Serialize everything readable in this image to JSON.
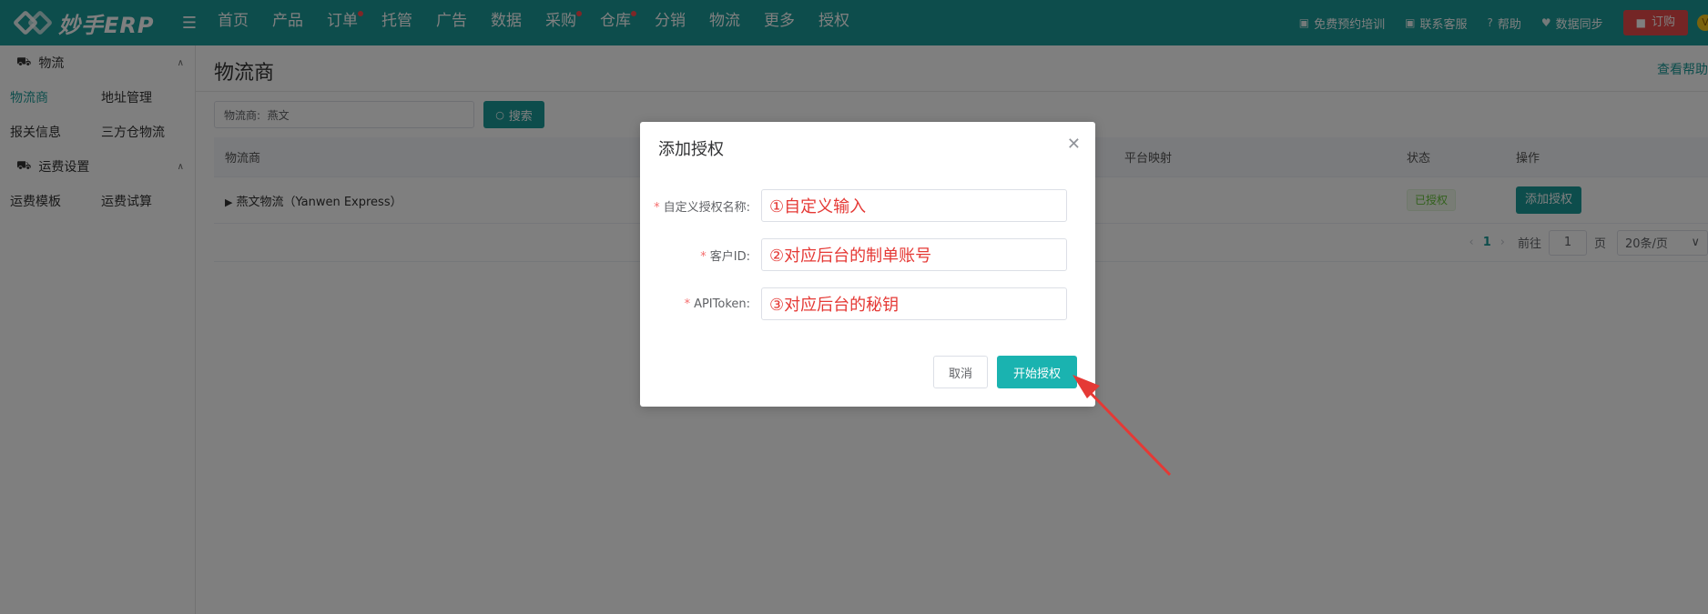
{
  "app": {
    "logo_text": "妙手ERP"
  },
  "nav": {
    "items": [
      {
        "label": "首页",
        "dot": false
      },
      {
        "label": "产品",
        "dot": false
      },
      {
        "label": "订单",
        "dot": true
      },
      {
        "label": "托管",
        "dot": false
      },
      {
        "label": "广告",
        "dot": false
      },
      {
        "label": "数据",
        "dot": false
      },
      {
        "label": "采购",
        "dot": true
      },
      {
        "label": "仓库",
        "dot": true
      },
      {
        "label": "分销",
        "dot": false
      },
      {
        "label": "物流",
        "dot": false
      },
      {
        "label": "更多",
        "dot": false
      },
      {
        "label": "授权",
        "dot": false
      }
    ],
    "right": {
      "training": "免费预约培训",
      "service": "联系客服",
      "help": "帮助",
      "sync": "数据同步",
      "order": "订购",
      "vip": "V"
    }
  },
  "sidebar": {
    "group1": {
      "title": "物流",
      "items": [
        "物流商",
        "地址管理",
        "报关信息",
        "三方仓物流"
      ]
    },
    "group2": {
      "title": "运费设置",
      "items": [
        "运费模板",
        "运费试算"
      ]
    }
  },
  "main": {
    "title": "物流商",
    "help": "查看帮助",
    "filter_value": "物流商:  燕文",
    "search_label": "搜索",
    "table": {
      "headers": [
        "物流商",
        "平台映射",
        "状态",
        "操作"
      ],
      "rows": [
        {
          "name": "燕文物流（Yanwen Express）",
          "mapping": "",
          "status": "已授权",
          "action": "添加授权"
        }
      ]
    },
    "pager": {
      "current": "1",
      "goto_label": "前往",
      "page_value": "1",
      "page_unit": "页",
      "size": "20条/页"
    }
  },
  "dialog": {
    "title": "添加授权",
    "fields": [
      {
        "label": "自定义授权名称:",
        "value": "①自定义输入"
      },
      {
        "label": "客户ID:",
        "value": "②对应后台的制单账号"
      },
      {
        "label": "APIToken:",
        "value": "③对应后台的秘钥"
      }
    ],
    "cancel": "取消",
    "submit": "开始授权"
  },
  "colors": {
    "brand": "#1b9b98",
    "danger": "#e94b4b",
    "annotation": "#e53935"
  }
}
